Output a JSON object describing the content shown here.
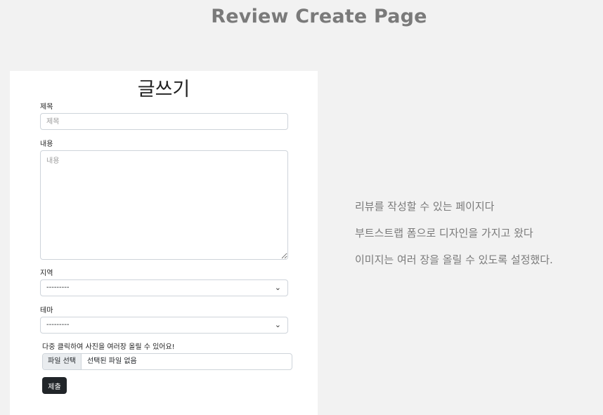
{
  "header": {
    "title": "Review Create Page"
  },
  "form": {
    "heading": "글쓰기",
    "title_label": "제목",
    "title_placeholder": "제목",
    "content_label": "내용",
    "content_placeholder": "내용",
    "region_label": "지역",
    "region_value": "---------",
    "theme_label": "테마",
    "theme_value": "---------",
    "upload_hint": "다중 클릭하여 사진을 여러장 올릴 수 있어요!",
    "file_button_label": "파일 선택",
    "file_status": "선택된 파일 없음",
    "submit_label": "제출"
  },
  "description": {
    "lines": [
      "리뷰를 작성할 수 있는 페이지다",
      "부트스트랩 폼으로 디자인을 가지고 왔다",
      "이미지는 여러 장을 올릴 수 있도록 설정했다."
    ]
  },
  "icons": {
    "select_chevron": "chevron-down-icon"
  }
}
